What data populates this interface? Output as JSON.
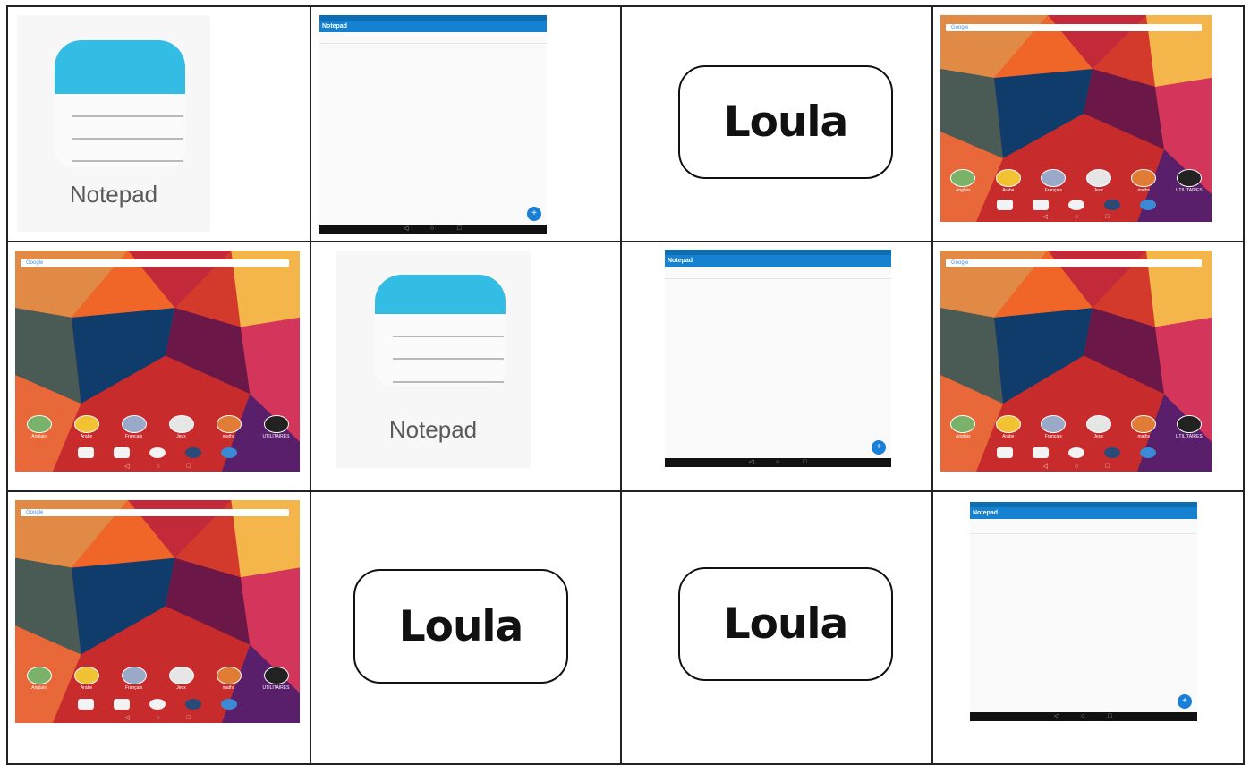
{
  "notepad_icon": {
    "label": "Notepad",
    "icon": "notepad-icon"
  },
  "notepad_app": {
    "title": "Notepad",
    "fab": "+",
    "nav": [
      "◁",
      "○",
      "□"
    ]
  },
  "loula": {
    "text": "Loula"
  },
  "home_screen": {
    "search": "Google",
    "apps": [
      "Anglais",
      "Arabe",
      "Français",
      "Jeux",
      "maths",
      "UTILITAIRES"
    ],
    "nav": [
      "◁",
      "○",
      "□"
    ]
  },
  "colors": {
    "notepad_blue": "#33bce4",
    "app_bar": "#1582d1",
    "grid_line": "#222222"
  }
}
